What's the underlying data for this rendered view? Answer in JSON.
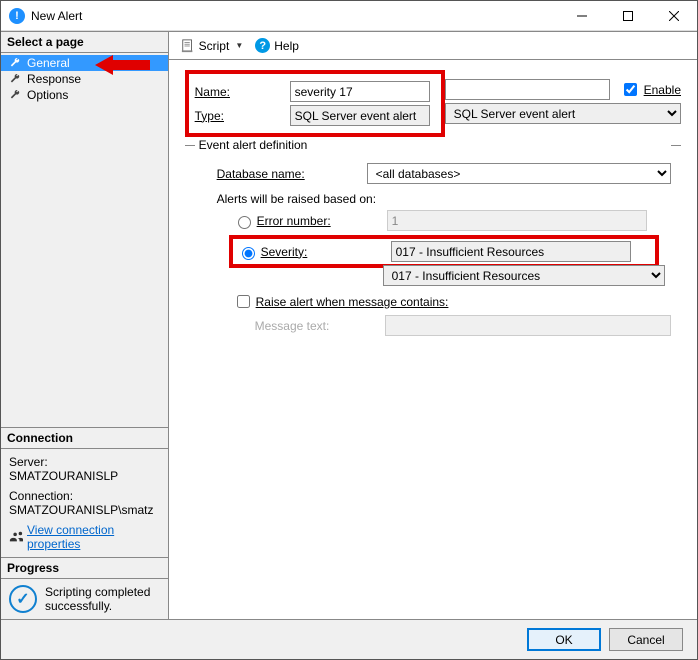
{
  "window": {
    "title": "New Alert"
  },
  "sidebar": {
    "header": "Select a page",
    "items": [
      {
        "label": "General",
        "selected": true
      },
      {
        "label": "Response",
        "selected": false
      },
      {
        "label": "Options",
        "selected": false
      }
    ]
  },
  "connection": {
    "header": "Connection",
    "server_label": "Server:",
    "server_value": "SMATZOURANISLP",
    "conn_label": "Connection:",
    "conn_value": "SMATZOURANISLP\\smatz",
    "link": "View connection properties"
  },
  "progress": {
    "header": "Progress",
    "status": "Scripting completed successfully."
  },
  "toolbar": {
    "script": "Script",
    "help": "Help"
  },
  "form": {
    "name_label": "Name:",
    "name_value": "severity 17",
    "enable_label": "Enable",
    "enable_checked": true,
    "type_label": "Type:",
    "type_value": "SQL Server event alert",
    "fieldset_legend": "Event alert definition",
    "database_label": "Database name:",
    "database_value": "<all databases>",
    "based_on_label": "Alerts will be raised based on:",
    "error_number_label": "Error number:",
    "error_number_value": "1",
    "severity_label": "Severity:",
    "severity_value": "017 - Insufficient Resources",
    "raise_label": "Raise alert when message contains:",
    "message_text_label": "Message text:",
    "message_text_value": ""
  },
  "buttons": {
    "ok": "OK",
    "cancel": "Cancel"
  }
}
